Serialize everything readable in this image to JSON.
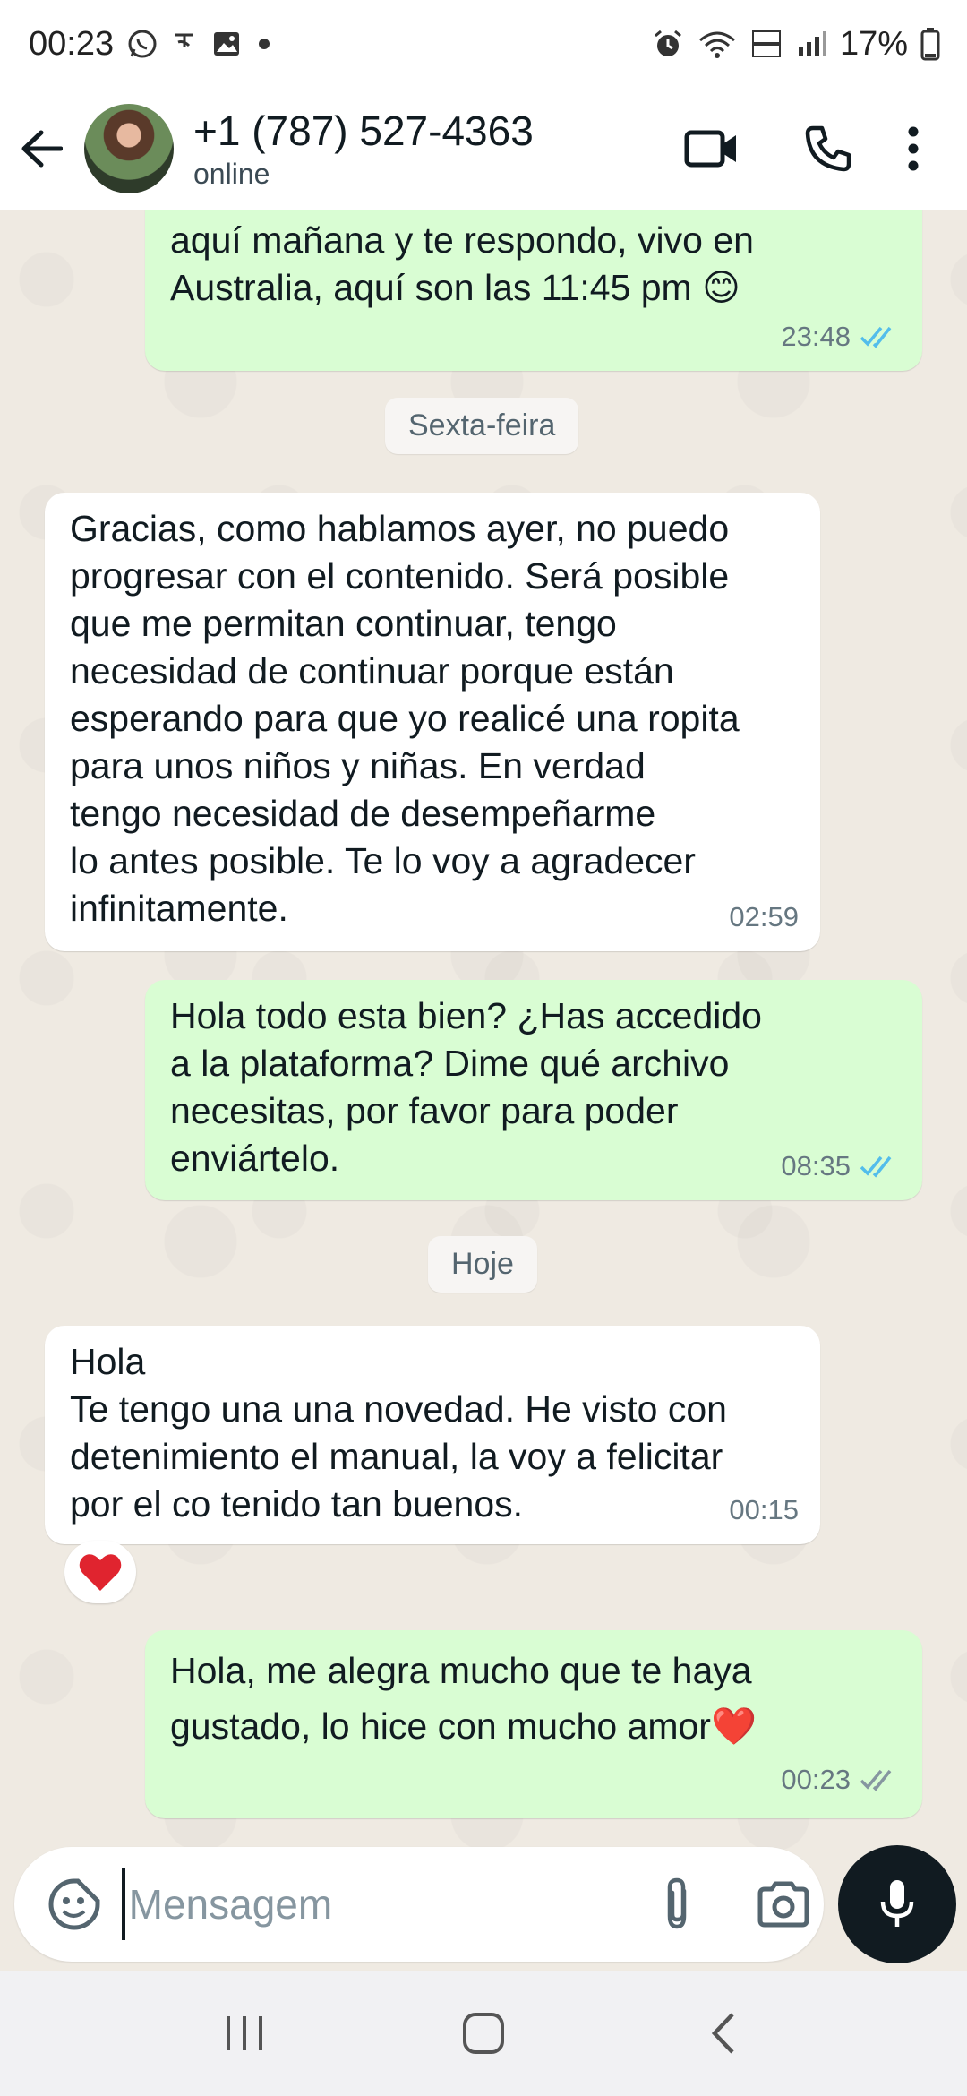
{
  "status_bar": {
    "time": "00:23",
    "battery": "17%",
    "left_icons": [
      "whatsapp-icon",
      "notification-icon",
      "gallery-icon",
      "dot-icon"
    ],
    "right_icons": [
      "alarm-icon",
      "wifi-icon",
      "volte-icon",
      "signal-icon",
      "battery-icon"
    ]
  },
  "header": {
    "contact_name": "+1 (787) 527-4363",
    "contact_status": "online"
  },
  "messages": [
    {
      "direction": "out",
      "text": "aquí mañana y te respondo, vivo en\nAustralia, aquí son las 11:45 pm 😊",
      "time": "23:48",
      "status": "read"
    },
    {
      "day": "Sexta-feira"
    },
    {
      "direction": "in",
      "text": "Gracias, como hablamos ayer, no puedo\nprogresar con el contenido. Será posible\nque me permitan continuar, tengo\nnecesidad de continuar porque  están\nesperando para que yo realicé una ropita\npara unos niños y niñas. En verdad\ntengo necesidad de desempeñarme\nlo antes posible. Te lo voy a agradecer\ninfinitamente.",
      "time": "02:59"
    },
    {
      "direction": "out",
      "text": "Hola todo esta bien?  ¿Has accedido\na la plataforma?  Dime qué archivo\nnecesitas, por favor para poder\nenviártelo.",
      "time": "08:35",
      "status": "read"
    },
    {
      "day": "Hoje"
    },
    {
      "direction": "in",
      "text": "Hola\nTe tengo una  una novedad. He visto con\ndetenimiento el manual, la voy a felicitar\npor el co tenido tan buenos.",
      "time": "00:15",
      "reaction": "❤️"
    },
    {
      "direction": "out",
      "text": "Hola, me alegra mucho que te haya\ngustado, lo hice con mucho amor❤️",
      "time": "00:23",
      "status": "delivered"
    }
  ],
  "composer": {
    "placeholder": "Mensagem"
  },
  "colors": {
    "outgoing_bubble": "#d9fdd3",
    "incoming_bubble": "#ffffff",
    "chat_background": "#efeae2",
    "read_tick": "#53bdeb",
    "delivered_tick": "#8696a0"
  }
}
